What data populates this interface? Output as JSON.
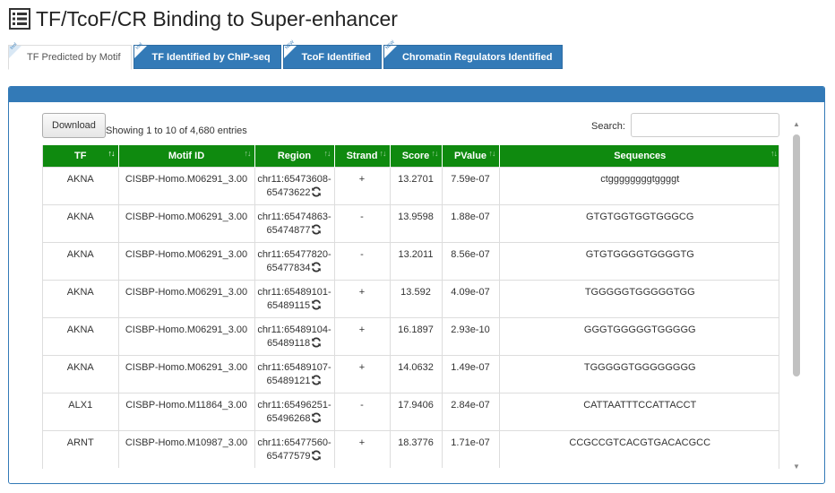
{
  "page": {
    "title": "TF/TcoF/CR Binding to Super-enhancer"
  },
  "tabs": [
    {
      "label": "TF Predicted by Motif",
      "badge": "tool",
      "active": true
    },
    {
      "label": "TF Identified by ChIP-seq",
      "badge": "tool",
      "active": false
    },
    {
      "label": "TcoF Identified",
      "badge": "NEW",
      "active": false
    },
    {
      "label": "Chromatin Regulators Identified",
      "badge": "NEW",
      "active": false
    }
  ],
  "toolbar": {
    "download_label": "Download",
    "info": "Showing 1 to 10 of 4,680 entries",
    "search_label": "Search:",
    "search_value": ""
  },
  "table": {
    "headers": [
      "TF",
      "Motif ID",
      "Region",
      "Strand",
      "Score",
      "PValue",
      "Sequences"
    ],
    "rows": [
      {
        "tf": "AKNA",
        "motif": "CISBP-Homo.M06291_3.00",
        "region1": "chr11:65473608-",
        "region2": "65473622",
        "strand": "+",
        "score": "13.2701",
        "pvalue": "7.59e-07",
        "seq": "ctggggggggtggggt"
      },
      {
        "tf": "AKNA",
        "motif": "CISBP-Homo.M06291_3.00",
        "region1": "chr11:65474863-",
        "region2": "65474877",
        "strand": "-",
        "score": "13.9598",
        "pvalue": "1.88e-07",
        "seq": "GTGTGGTGGTGGGCG"
      },
      {
        "tf": "AKNA",
        "motif": "CISBP-Homo.M06291_3.00",
        "region1": "chr11:65477820-",
        "region2": "65477834",
        "strand": "-",
        "score": "13.2011",
        "pvalue": "8.56e-07",
        "seq": "GTGTGGGGTGGGGTG"
      },
      {
        "tf": "AKNA",
        "motif": "CISBP-Homo.M06291_3.00",
        "region1": "chr11:65489101-",
        "region2": "65489115",
        "strand": "+",
        "score": "13.592",
        "pvalue": "4.09e-07",
        "seq": "TGGGGGTGGGGGTGG"
      },
      {
        "tf": "AKNA",
        "motif": "CISBP-Homo.M06291_3.00",
        "region1": "chr11:65489104-",
        "region2": "65489118",
        "strand": "+",
        "score": "16.1897",
        "pvalue": "2.93e-10",
        "seq": "GGGTGGGGGTGGGGG"
      },
      {
        "tf": "AKNA",
        "motif": "CISBP-Homo.M06291_3.00",
        "region1": "chr11:65489107-",
        "region2": "65489121",
        "strand": "+",
        "score": "14.0632",
        "pvalue": "1.49e-07",
        "seq": "TGGGGGTGGGGGGGG"
      },
      {
        "tf": "ALX1",
        "motif": "CISBP-Homo.M11864_3.00",
        "region1": "chr11:65496251-",
        "region2": "65496268",
        "strand": "-",
        "score": "17.9406",
        "pvalue": "2.84e-07",
        "seq": "CATTAATTTCCATTACCT"
      },
      {
        "tf": "ARNT",
        "motif": "CISBP-Homo.M10987_3.00",
        "region1": "chr11:65477560-",
        "region2": "65477579",
        "strand": "+",
        "score": "18.3776",
        "pvalue": "1.71e-07",
        "seq": "CCGCCGTCACGTGACACGCC"
      }
    ]
  },
  "colors": {
    "primary": "#337ab7",
    "header_green": "#0f8a0f"
  }
}
